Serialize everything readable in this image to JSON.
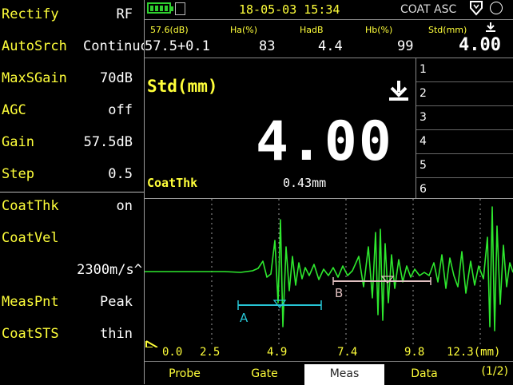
{
  "settings": [
    {
      "label": "Rectify",
      "value": "RF"
    },
    {
      "label": "AutoSrch",
      "value": "Continuous"
    },
    {
      "label": "MaxSGain",
      "value": "70dB"
    },
    {
      "label": "AGC",
      "value": "off"
    },
    {
      "label": "Gain",
      "value": "57.5dB"
    },
    {
      "label": "Step",
      "value": "0.5"
    },
    {
      "label": "CoatThk",
      "value": "on"
    },
    {
      "label": "CoatVel",
      "value": ""
    },
    {
      "label": "",
      "value": "2300m/s^"
    },
    {
      "label": "MeasPnt",
      "value": "Peak"
    },
    {
      "label": "CoatSTS",
      "value": "thin"
    }
  ],
  "status": {
    "datetime": "18-05-03 15:34",
    "mode": "COAT ASC",
    "battery_level": 1.0,
    "icons": [
      "battery-icon",
      "sd-card-icon",
      "probe-icon",
      "circle-icon"
    ]
  },
  "readout": {
    "headers": [
      "57.6(dB)",
      "Ha(%)",
      "HadB",
      "Hb(%)",
      "Std(mm)"
    ],
    "values": [
      "57.5+0.1",
      "83",
      "4.4",
      "99",
      "4.00"
    ]
  },
  "main": {
    "label": "Std(mm)",
    "value": "4.00",
    "coat_label": "CoatThk",
    "coat_value": "0.43mm"
  },
  "list_items": [
    "1",
    "2",
    "3",
    "4",
    "5",
    "6"
  ],
  "waveform": {
    "gate_a": "A",
    "gate_b": "B",
    "axis_labels": [
      "0.0",
      "2.5",
      "4.9",
      "7.4",
      "9.8",
      "12.3(mm)"
    ],
    "colors": {
      "trace": "#2ee82e",
      "gate_a": "#27c6d6",
      "gate_b": "#e0c0c0",
      "grid": "#9a9a9a"
    }
  },
  "tabs": [
    {
      "label": "Probe",
      "active": false
    },
    {
      "label": "Gate",
      "active": false
    },
    {
      "label": "Meas",
      "active": true
    },
    {
      "label": "Data",
      "active": false
    }
  ],
  "page_indicator": "(1/2)"
}
